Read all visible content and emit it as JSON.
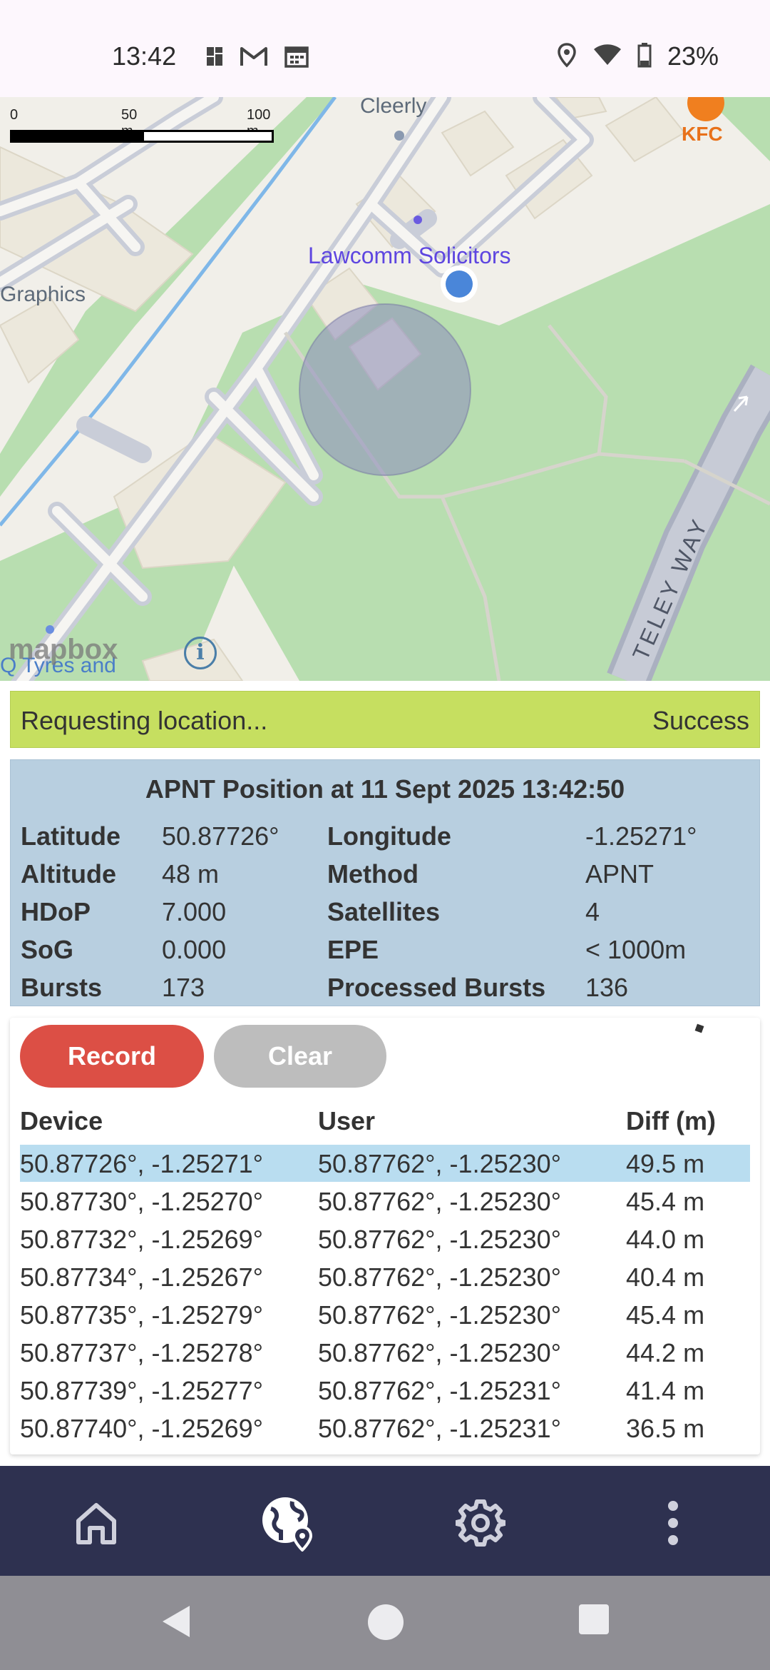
{
  "status_bar": {
    "time": "13:42",
    "battery_percent": "23%",
    "left_icons": [
      "notification-icon",
      "gmail-icon",
      "calendar-icon"
    ],
    "right_icons": [
      "location-pin-icon",
      "wifi-icon",
      "battery-icon"
    ]
  },
  "map": {
    "scale": {
      "labels": [
        "0",
        "50 m",
        "100 m"
      ]
    },
    "labels": {
      "cleerly": "Cleerly",
      "kfc": "KFC",
      "poi": "Lawcomm Solicitors",
      "graphics": "Graphics",
      "street": "TELEY WAY",
      "tyres": "Q Tyres and"
    },
    "attribution": "mapbox",
    "info_symbol": "i"
  },
  "request_status": {
    "message": "Requesting location...",
    "result": "Success",
    "color": "#c6df60"
  },
  "position": {
    "title": "APNT Position at 11 Sept 2025 13:42:50",
    "rows": [
      {
        "label1": "Latitude",
        "value1": "50.87726°",
        "label2": "Longitude",
        "value2": "-1.25271°"
      },
      {
        "label1": "Altitude",
        "value1": "48 m",
        "label2": "Method",
        "value2": "APNT"
      },
      {
        "label1": "HDoP",
        "value1": "7.000",
        "label2": "Satellites",
        "value2": "4"
      },
      {
        "label1": "SoG",
        "value1": "0.000",
        "label2": "EPE",
        "value2": "< 1000m"
      },
      {
        "label1": "Bursts",
        "value1": "173",
        "label2": "Processed Bursts",
        "value2": "136"
      }
    ]
  },
  "log": {
    "record_label": "Record",
    "clear_label": "Clear",
    "headers": {
      "device": "Device",
      "user": "User",
      "diff": "Diff (m)"
    },
    "rows": [
      {
        "device": "50.87726°, -1.25271°",
        "user": "50.87762°, -1.25230°",
        "diff": "49.5 m",
        "selected": true
      },
      {
        "device": "50.87730°, -1.25270°",
        "user": "50.87762°, -1.25230°",
        "diff": "45.4 m"
      },
      {
        "device": "50.87732°, -1.25269°",
        "user": "50.87762°, -1.25230°",
        "diff": "44.0 m"
      },
      {
        "device": "50.87734°, -1.25267°",
        "user": "50.87762°, -1.25230°",
        "diff": "40.4 m"
      },
      {
        "device": "50.87735°, -1.25279°",
        "user": "50.87762°, -1.25230°",
        "diff": "45.4 m"
      },
      {
        "device": "50.87737°, -1.25278°",
        "user": "50.87762°, -1.25230°",
        "diff": "44.2 m"
      },
      {
        "device": "50.87739°, -1.25277°",
        "user": "50.87762°, -1.25231°",
        "diff": "41.4 m"
      },
      {
        "device": "50.87740°, -1.25269°",
        "user": "50.87762°, -1.25231°",
        "diff": "36.5 m"
      }
    ]
  },
  "bottom_nav": {
    "items": [
      "home-icon",
      "globe-location-icon",
      "settings-gear-icon",
      "more-vert-icon"
    ],
    "active": "globe-location-icon"
  },
  "system_nav": [
    "back-icon",
    "home-circle-icon",
    "recents-icon"
  ],
  "colors": {
    "record": "#dc4f45",
    "clear": "#bdbdbd",
    "panel": "#b8cfe0",
    "selected_row": "#b9ddf0",
    "nav_bar": "#2e3150"
  }
}
